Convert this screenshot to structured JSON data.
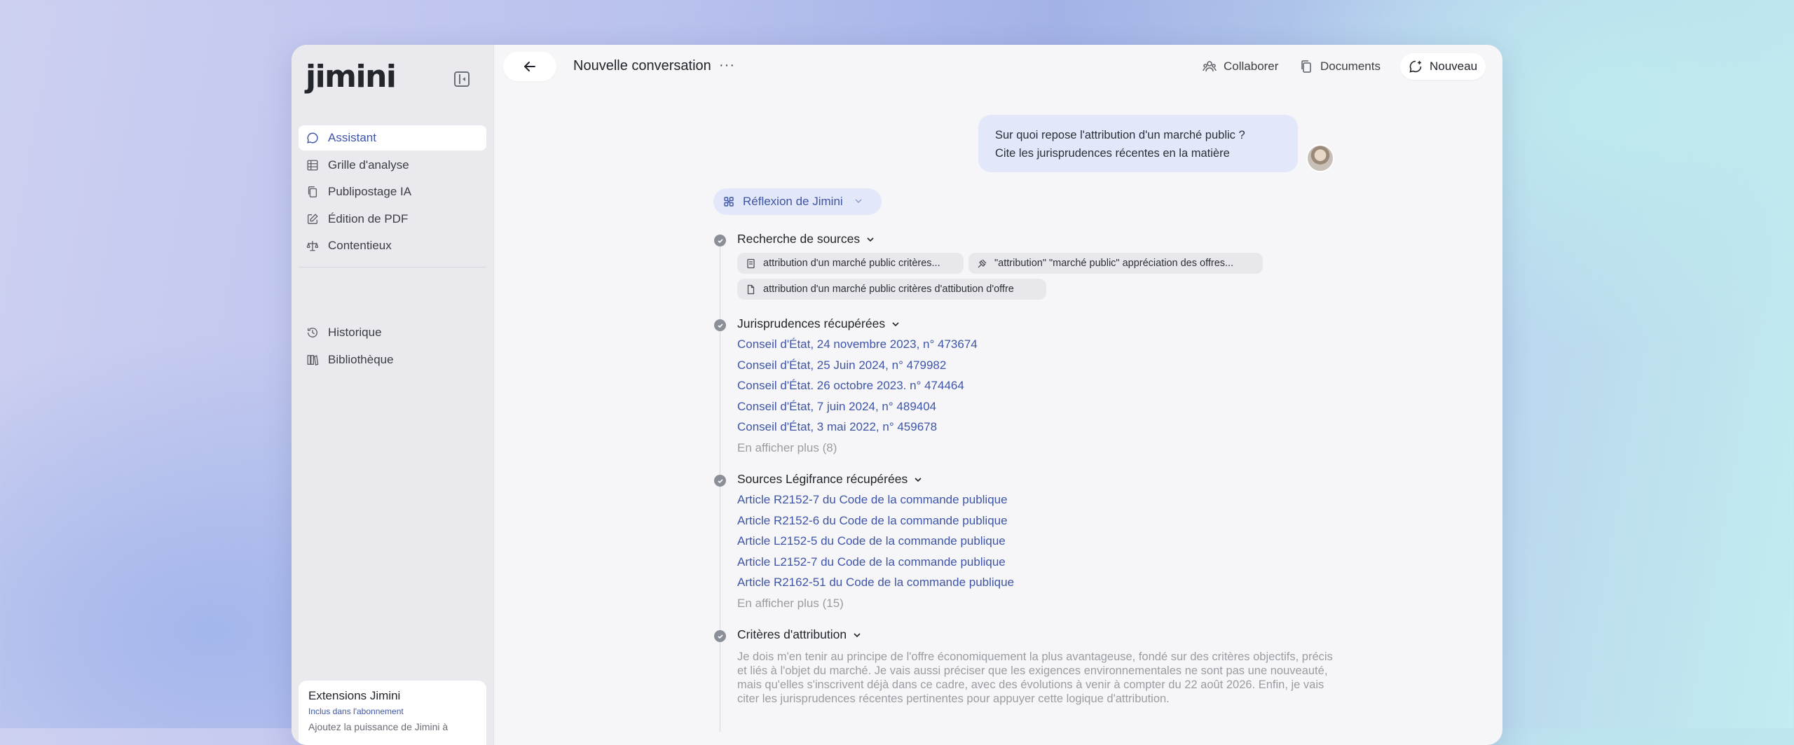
{
  "sidebar": {
    "logo": "jimini",
    "items": [
      {
        "label": "Assistant",
        "icon": "chat-bubble-icon",
        "active": true
      },
      {
        "label": "Grille d'analyse",
        "icon": "table-grid-icon"
      },
      {
        "label": "Publipostage IA",
        "icon": "copy-documents-icon"
      },
      {
        "label": "Édition de PDF",
        "icon": "pencil-edit-icon"
      },
      {
        "label": "Contentieux",
        "icon": "scale-icon"
      }
    ],
    "items2": [
      {
        "label": "Historique",
        "icon": "history-icon"
      },
      {
        "label": "Bibliothèque",
        "icon": "library-icon"
      }
    ],
    "extensions": {
      "title": "Extensions Jimini",
      "subtitle": "Inclus dans l'abonnement",
      "description": "Ajoutez la puissance de Jimini à"
    }
  },
  "header": {
    "title": "Nouvelle conversation",
    "more": "···",
    "collaborate": "Collaborer",
    "documents": "Documents",
    "new": "Nouveau"
  },
  "chat": {
    "user_line1": "Sur quoi repose l'attribution d'un marché public ?",
    "user_line2": "Cite les jurisprudences récentes en la matière",
    "reflection_label": "Réflexion de Jimini",
    "steps": {
      "search": {
        "title": "Recherche de sources",
        "chips": [
          "attribution d'un marché public critères...",
          "\"attribution\" \"marché public\" appréciation des offres...",
          "attribution d'un marché public critères d'attibution d'offre"
        ]
      },
      "juris": {
        "title": "Jurisprudences récupérées",
        "links": [
          "Conseil d'État, 24 novembre 2023, n° 473674",
          "Conseil d'État, 25 Juin 2024, n° 479982",
          "Conseil d'État. 26 octobre 2023. n° 474464",
          "Conseil d'État, 7 juin 2024, n° 489404",
          "Conseil d'État, 3 mai 2022, n° 459678"
        ],
        "more": "En afficher plus (8)"
      },
      "legifrance": {
        "title": "Sources Légifrance récupérées",
        "links": [
          "Article R2152-7 du Code de la commande publique",
          "Article R2152-6 du Code de la commande publique",
          "Article L2152-5 du Code de la commande publique",
          "Article L2152-7 du Code de la commande publique",
          "Article R2162-51 du Code de la commande publique"
        ],
        "more": "En afficher plus (15)"
      },
      "criteria": {
        "title": "Critères d'attribution",
        "text": "Je dois m'en tenir au principe de l'offre économiquement la plus avantageuse, fondé sur des critères objectifs, précis et liés à l'objet du marché. Je vais aussi préciser que les exigences environnementales ne sont pas une nouveauté, mais qu'elles s'inscrivent déjà dans ce cadre, avec des évolutions à venir à compter du 22 août 2026. Enfin, je vais citer les jurisprudences récentes pertinentes pour appuyer cette logique d'attribution."
      }
    }
  },
  "colors": {
    "accent": "#3e55a7",
    "bubble": "#e2e8f9",
    "muted": "#9a9ca3"
  }
}
